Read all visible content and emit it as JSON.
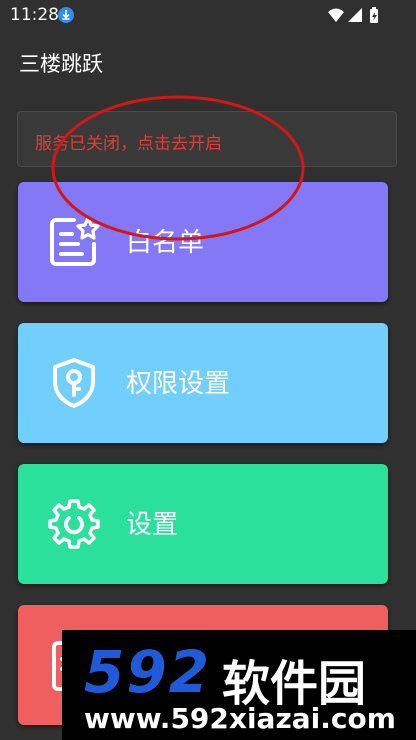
{
  "status_bar": {
    "time": "11:28",
    "icons": [
      "download-icon",
      "wifi-icon",
      "signal-icon",
      "battery-icon"
    ]
  },
  "app": {
    "title": "三楼跳跃"
  },
  "notice": {
    "text": "服务已关闭，点击去开启",
    "color": "#e53b34"
  },
  "menu": {
    "items": [
      {
        "label": "白名单",
        "icon": "whitelist-icon",
        "color": "#8478f7"
      },
      {
        "label": "权限设置",
        "icon": "shield-key-icon",
        "color": "#72cefc"
      },
      {
        "label": "设置",
        "icon": "gear-icon",
        "color": "#2be09b"
      },
      {
        "label": "",
        "icon": "document-icon",
        "color": "#ef5f5f"
      }
    ]
  },
  "watermark": {
    "logo": "592",
    "name": "软件园",
    "url": "www.592xiazai.com"
  }
}
